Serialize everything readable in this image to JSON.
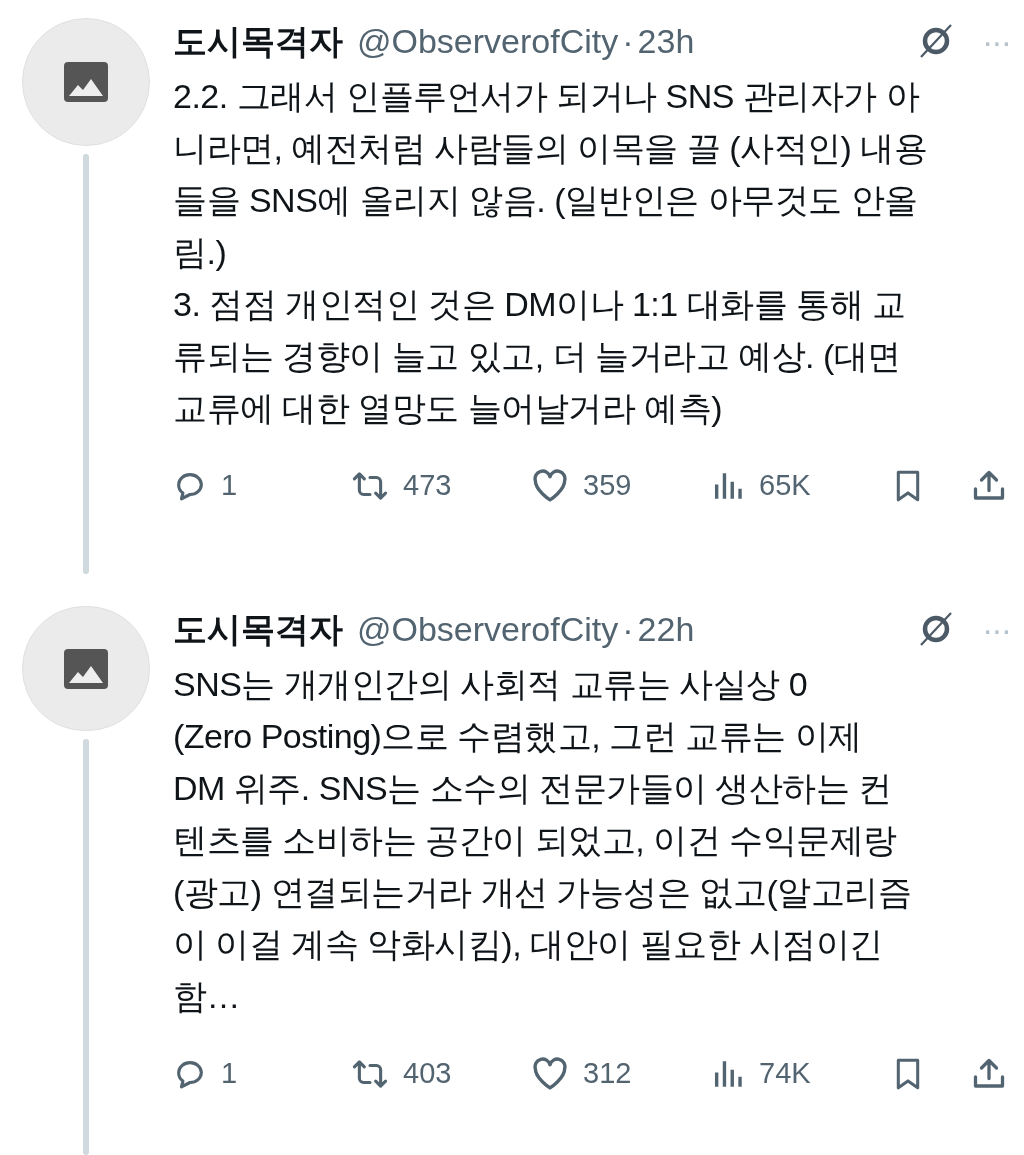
{
  "tweets": [
    {
      "name": "도시목격자",
      "handle": "@ObserverofCity",
      "separator": "·",
      "time": "23h",
      "more": "···",
      "body": "2.2. 그래서 인플루언서가 되거나 SNS 관리자가 아\n니라면, 예전처럼 사람들의 이목을 끌 (사적인) 내용\n들을 SNS에 올리지 않음. (일반인은 아무것도 안올\n림.)\n3. 점점 개인적인 것은 DM이나 1:1 대화를 통해 교\n류되는 경향이 늘고 있고, 더 늘거라고 예상. (대면\n교류에 대한 열망도 늘어날거라 예측)",
      "replies": "1",
      "reposts": "473",
      "likes": "359",
      "views": "65K"
    },
    {
      "name": "도시목격자",
      "handle": "@ObserverofCity",
      "separator": "·",
      "time": "22h",
      "more": "···",
      "body": "SNS는 개개인간의 사회적 교류는 사실상 0\n(Zero Posting)으로 수렴했고, 그런 교류는 이제\nDM 위주. SNS는 소수의 전문가들이 생산하는 컨\n텐츠를 소비하는 공간이 되었고, 이건 수익문제랑\n(광고) 연결되는거라 개선 가능성은 없고(알고리즘\n이 이걸 계속 악화시킴), 대안이 필요한 시점이긴\n함…",
      "replies": "1",
      "reposts": "403",
      "likes": "312",
      "views": "74K"
    }
  ]
}
